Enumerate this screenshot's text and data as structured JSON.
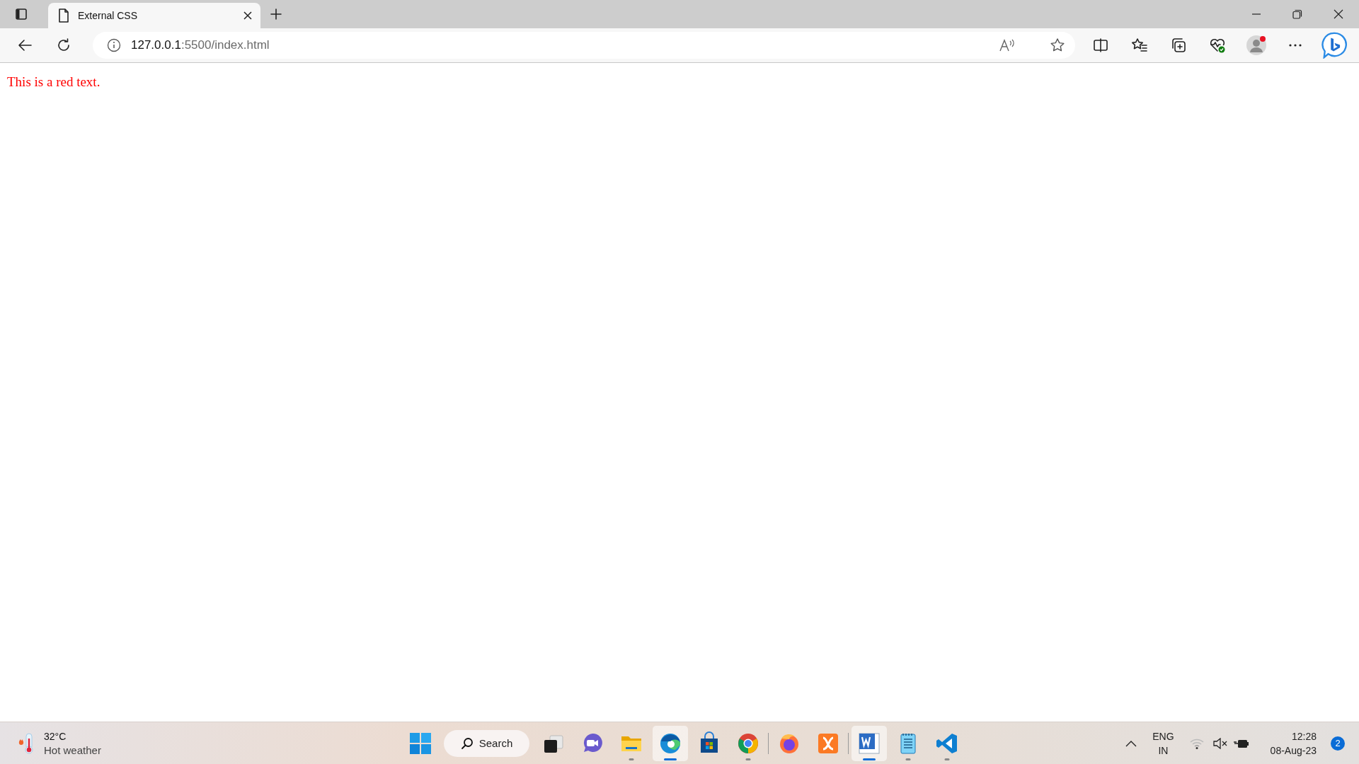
{
  "browser": {
    "tabs": [
      {
        "title": "External CSS",
        "selected": true
      }
    ],
    "address": {
      "host": "127.0.0.1",
      "path": ":5500/index.html"
    },
    "profile": {
      "notification": true
    }
  },
  "page": {
    "text": "This is a red text."
  },
  "taskbar": {
    "weather": {
      "temperature": "32°C",
      "condition": "Hot weather"
    },
    "search": {
      "label": "Search"
    },
    "apps": [
      {
        "kind": "task-view",
        "running": false,
        "active": false
      },
      {
        "kind": "chat",
        "running": false,
        "active": false
      },
      {
        "kind": "folder",
        "running": true,
        "active": false
      },
      {
        "kind": "edge",
        "running": true,
        "active": true
      },
      {
        "kind": "store",
        "running": false,
        "active": false
      },
      {
        "kind": "chrome",
        "running": true,
        "active": false
      },
      {
        "kind": "separator"
      },
      {
        "kind": "firefox",
        "running": false,
        "active": false
      },
      {
        "kind": "xampp",
        "running": false,
        "active": false
      },
      {
        "kind": "separator"
      },
      {
        "kind": "word",
        "running": true,
        "active": true
      },
      {
        "kind": "notepad",
        "running": true,
        "active": false
      },
      {
        "kind": "vscode",
        "running": true,
        "active": false
      }
    ],
    "language": {
      "line_1": "ENG",
      "line_2": "IN"
    },
    "clock": {
      "time": "12:28",
      "date": "08-Aug-23"
    },
    "notifications": {
      "count": "2"
    }
  }
}
